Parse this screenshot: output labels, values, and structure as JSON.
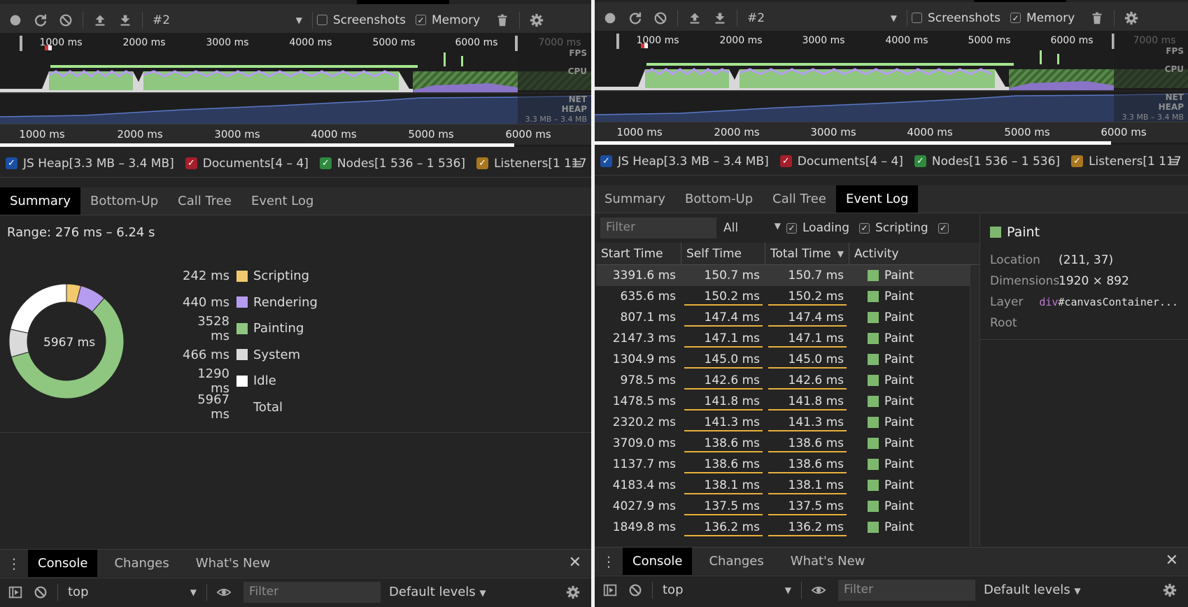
{
  "toolbar": {
    "recording": "#2",
    "screenshots_label": "Screenshots",
    "memory_label": "Memory"
  },
  "overview": {
    "top_ticks": [
      "1000 ms",
      "2000 ms",
      "3000 ms",
      "4000 ms",
      "5000 ms",
      "6000 ms",
      "7000 ms"
    ],
    "bottom_ticks": [
      "1000 ms",
      "2000 ms",
      "3000 ms",
      "4000 ms",
      "5000 ms",
      "6000 ms"
    ],
    "lanes": {
      "fps": "FPS",
      "cpu": "CPU",
      "net": "NET",
      "heap": "HEAP"
    },
    "heap_range": "3.3 MB – 3.4 MB"
  },
  "counters": {
    "js_heap": "JS Heap[3.3 MB – 3.4 MB]",
    "documents": "Documents[4 – 4]",
    "nodes": "Nodes[1 536 – 1 536]",
    "listeners": "Listeners[1 117"
  },
  "tabs": [
    "Summary",
    "Bottom-Up",
    "Call Tree",
    "Event Log"
  ],
  "summary": {
    "range": "Range: 276 ms – 6.24 s",
    "total_center": "5967 ms",
    "rows": [
      {
        "value": "242 ms",
        "name": "Scripting",
        "color": "#f2c96d"
      },
      {
        "value": "440 ms",
        "name": "Rendering",
        "color": "#b69cf0"
      },
      {
        "value": "3528 ms",
        "name": "Painting",
        "color": "#8fc780"
      },
      {
        "value": "466 ms",
        "name": "System",
        "color": "#dadada"
      },
      {
        "value": "1290 ms",
        "name": "Idle",
        "color": "#ffffff"
      }
    ],
    "total": {
      "value": "5967 ms",
      "name": "Total"
    }
  },
  "event_log": {
    "filter_placeholder": "Filter",
    "type_select": "All",
    "loading_label": "Loading",
    "scripting_label": "Scripting",
    "columns": [
      "Start Time",
      "Self Time",
      "Total Time",
      "Activity"
    ],
    "rows": [
      {
        "start": "3391.6 ms",
        "self": "150.7 ms",
        "total": "150.7 ms",
        "activity": "Paint"
      },
      {
        "start": "635.6 ms",
        "self": "150.2 ms",
        "total": "150.2 ms",
        "activity": "Paint"
      },
      {
        "start": "807.1 ms",
        "self": "147.4 ms",
        "total": "147.4 ms",
        "activity": "Paint"
      },
      {
        "start": "2147.3 ms",
        "self": "147.1 ms",
        "total": "147.1 ms",
        "activity": "Paint"
      },
      {
        "start": "1304.9 ms",
        "self": "145.0 ms",
        "total": "145.0 ms",
        "activity": "Paint"
      },
      {
        "start": "978.5 ms",
        "self": "142.6 ms",
        "total": "142.6 ms",
        "activity": "Paint"
      },
      {
        "start": "1478.5 ms",
        "self": "141.8 ms",
        "total": "141.8 ms",
        "activity": "Paint"
      },
      {
        "start": "2320.2 ms",
        "self": "141.3 ms",
        "total": "141.3 ms",
        "activity": "Paint"
      },
      {
        "start": "3709.0 ms",
        "self": "138.6 ms",
        "total": "138.6 ms",
        "activity": "Paint"
      },
      {
        "start": "1137.7 ms",
        "self": "138.6 ms",
        "total": "138.6 ms",
        "activity": "Paint"
      },
      {
        "start": "4183.4 ms",
        "self": "138.1 ms",
        "total": "138.1 ms",
        "activity": "Paint"
      },
      {
        "start": "4027.9 ms",
        "self": "137.5 ms",
        "total": "137.5 ms",
        "activity": "Paint"
      },
      {
        "start": "1849.8 ms",
        "self": "136.2 ms",
        "total": "136.2 ms",
        "activity": "Paint"
      }
    ]
  },
  "details": {
    "title": "Paint",
    "location_label": "Location",
    "location": "(211, 37)",
    "dimensions_label": "Dimensions",
    "dimensions": "1920 × 892",
    "layer_label": "Layer",
    "layer_tag": "div",
    "layer_rest": "#canvasContainer...",
    "root_label": "Root"
  },
  "drawer": {
    "tabs": [
      "Console",
      "Changes",
      "What's New"
    ],
    "context": "top",
    "filter_placeholder": "Filter",
    "levels": "Default levels"
  }
}
